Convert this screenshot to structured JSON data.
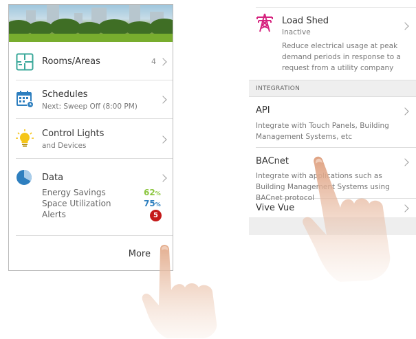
{
  "left_panel": {
    "rows": {
      "rooms": {
        "title": "Rooms/Areas",
        "count": "4"
      },
      "schedules": {
        "title": "Schedules",
        "subtitle": "Next: Sweep Off (8:00 PM)"
      },
      "lights": {
        "title": "Control Lights",
        "subtitle": "and Devices"
      },
      "data": {
        "title": "Data",
        "stats": [
          {
            "label": "Energy Savings",
            "value": "62",
            "unit": "%",
            "color": "#8cc63f"
          },
          {
            "label": "Space Utilization",
            "value": "75",
            "unit": "%",
            "color": "#2e7fbf"
          },
          {
            "label": "Alerts",
            "value": "5",
            "color": "#c41a1a"
          }
        ]
      }
    },
    "more_label": "More"
  },
  "right_panel": {
    "load_shed": {
      "title": "Load Shed",
      "status": "Inactive",
      "description": "Reduce electrical usage at peak demand periods in response to a request from a utility company"
    },
    "section_header": "INTEGRATION",
    "items": [
      {
        "title": "API",
        "description": "Integrate with Touch Panels, Building Management Systems, etc"
      },
      {
        "title": "BACnet",
        "description": "Integrate with applications such as Building Management Systems using BACnet protocol"
      },
      {
        "title": "Vive Vue",
        "description": ""
      }
    ]
  },
  "colors": {
    "accent_blue": "#2e7fbf",
    "teal": "#3aa89a",
    "bulb": "#f5c518",
    "tower_magenta": "#d6247f",
    "alert_red": "#c41a1a"
  },
  "icons": [
    "floorplan-icon",
    "calendar-icon",
    "lightbulb-icon",
    "pie-chart-icon",
    "transmission-tower-icon",
    "chevron-right-icon"
  ]
}
